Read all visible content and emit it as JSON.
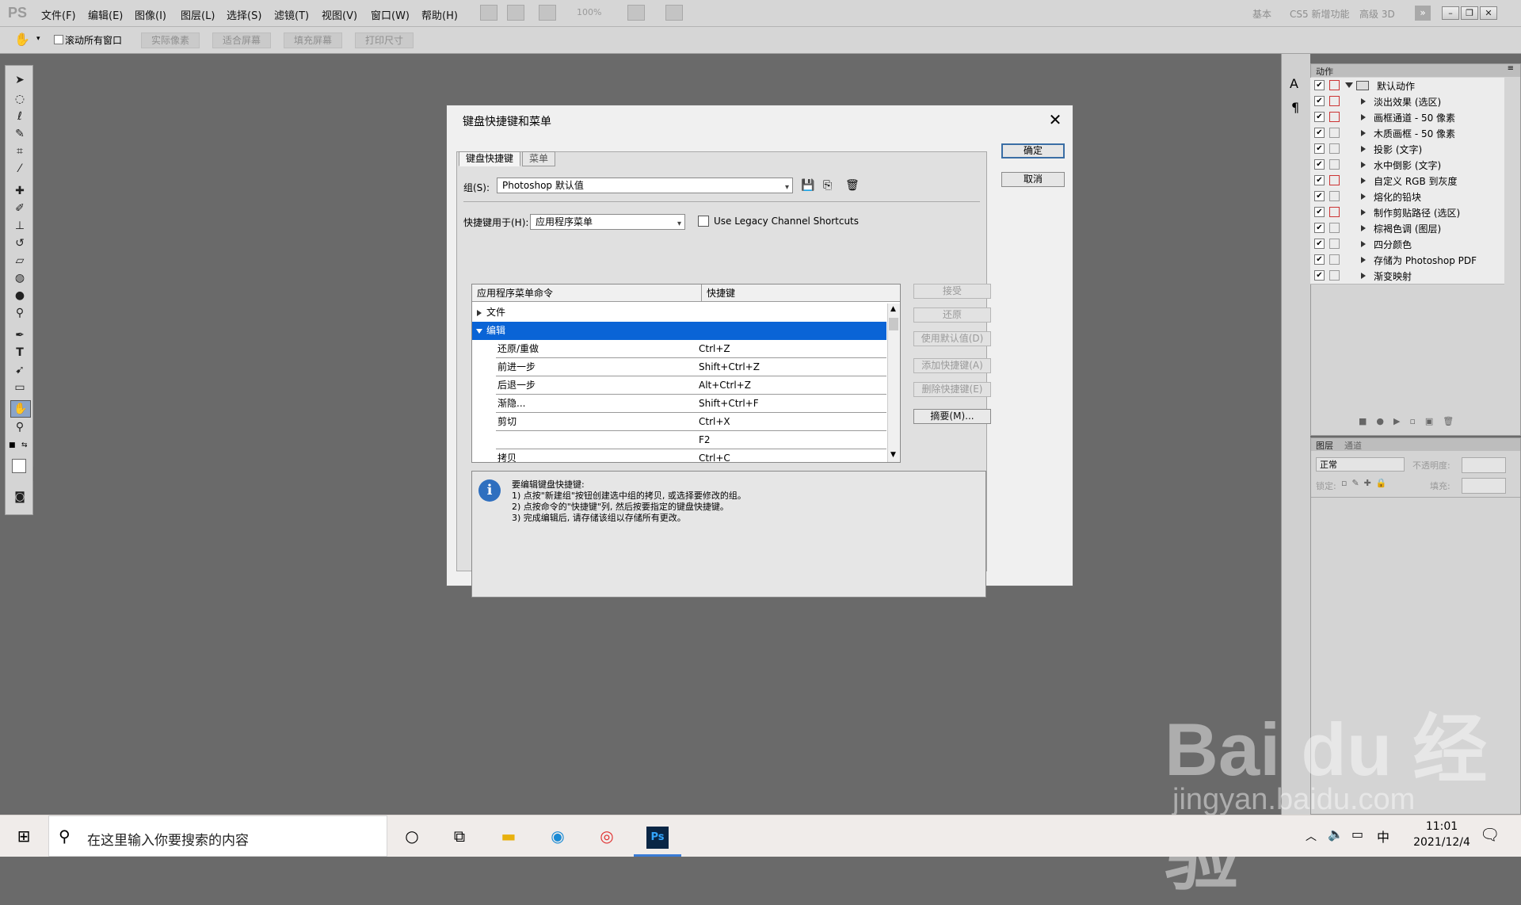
{
  "app": {
    "logo": "PS",
    "menu": [
      "文件(F)",
      "编辑(E)",
      "图像(I)",
      "图层(L)",
      "选择(S)",
      "滤镜(T)",
      "视图(V)",
      "窗口(W)",
      "帮助(H)"
    ],
    "zoom": "100%",
    "workspaces": [
      "基本",
      "CS5 新增功能",
      "高级 3D"
    ]
  },
  "options_bar": {
    "scroll_all_label": "滚动所有窗口",
    "buttons": [
      "实际像素",
      "适合屏幕",
      "填充屏幕",
      "打印尺寸"
    ]
  },
  "dialog": {
    "title": "键盘快捷键和菜单",
    "tabs": [
      "键盘快捷键",
      "菜单"
    ],
    "ok_label": "确定",
    "cancel_label": "取消",
    "set_label": "组(S):",
    "set_value": "Photoshop 默认值",
    "shortcuts_for_label": "快捷键用于(H):",
    "shortcuts_for_value": "应用程序菜单",
    "legacy_label": "Use Legacy Channel Shortcuts",
    "table": {
      "col1": "应用程序菜单命令",
      "col2": "快捷键",
      "groups": [
        {
          "label": "文件",
          "expanded": false
        },
        {
          "label": "编辑",
          "expanded": true
        }
      ],
      "rows": [
        {
          "command": "还原/重做",
          "shortcut": "Ctrl+Z"
        },
        {
          "command": "前进一步",
          "shortcut": "Shift+Ctrl+Z"
        },
        {
          "command": "后退一步",
          "shortcut": "Alt+Ctrl+Z"
        },
        {
          "command": "渐隐...",
          "shortcut": "Shift+Ctrl+F"
        },
        {
          "command": "剪切",
          "shortcut": "Ctrl+X"
        },
        {
          "command": "",
          "shortcut": "F2"
        },
        {
          "command": "拷贝",
          "shortcut": "Ctrl+C"
        }
      ]
    },
    "side_buttons": [
      "接受",
      "还原",
      "使用默认值(D)",
      "添加快捷键(A)",
      "删除快捷键(E)",
      "摘要(M)..."
    ],
    "info": {
      "heading": "要编辑键盘快捷键:",
      "line1": "1) 点按\"新建组\"按钮创建选中组的拷贝, 或选择要修改的组。",
      "line2": "2) 点按命令的\"快捷键\"列, 然后按要指定的键盘快捷键。",
      "line3": "3) 完成编辑后, 请存储该组以存储所有更改。"
    }
  },
  "actions_panel": {
    "tab": "动作",
    "set_name": "默认动作",
    "items": [
      "淡出效果 (选区)",
      "画框通道 - 50 像素",
      "木质画框 - 50 像素",
      "投影 (文字)",
      "水中倒影 (文字)",
      "自定义 RGB 到灰度",
      "熔化的铅块",
      "制作剪贴路径 (选区)",
      "棕褐色调 (图层)",
      "四分颜色",
      "存储为 Photoshop PDF",
      "渐变映射"
    ]
  },
  "layers_panel": {
    "tabs": [
      "图层",
      "通道"
    ],
    "blend_mode": "正常",
    "opacity_label": "不透明度:",
    "lock_label": "锁定:",
    "fill_label": "填充:"
  },
  "taskbar": {
    "search_placeholder": "在这里输入你要搜索的内容",
    "ime": "中",
    "time": "11:01",
    "date": "2021/12/4"
  },
  "watermark": {
    "brand": "Bai du 经验",
    "url": "jingyan.baidu.com"
  }
}
